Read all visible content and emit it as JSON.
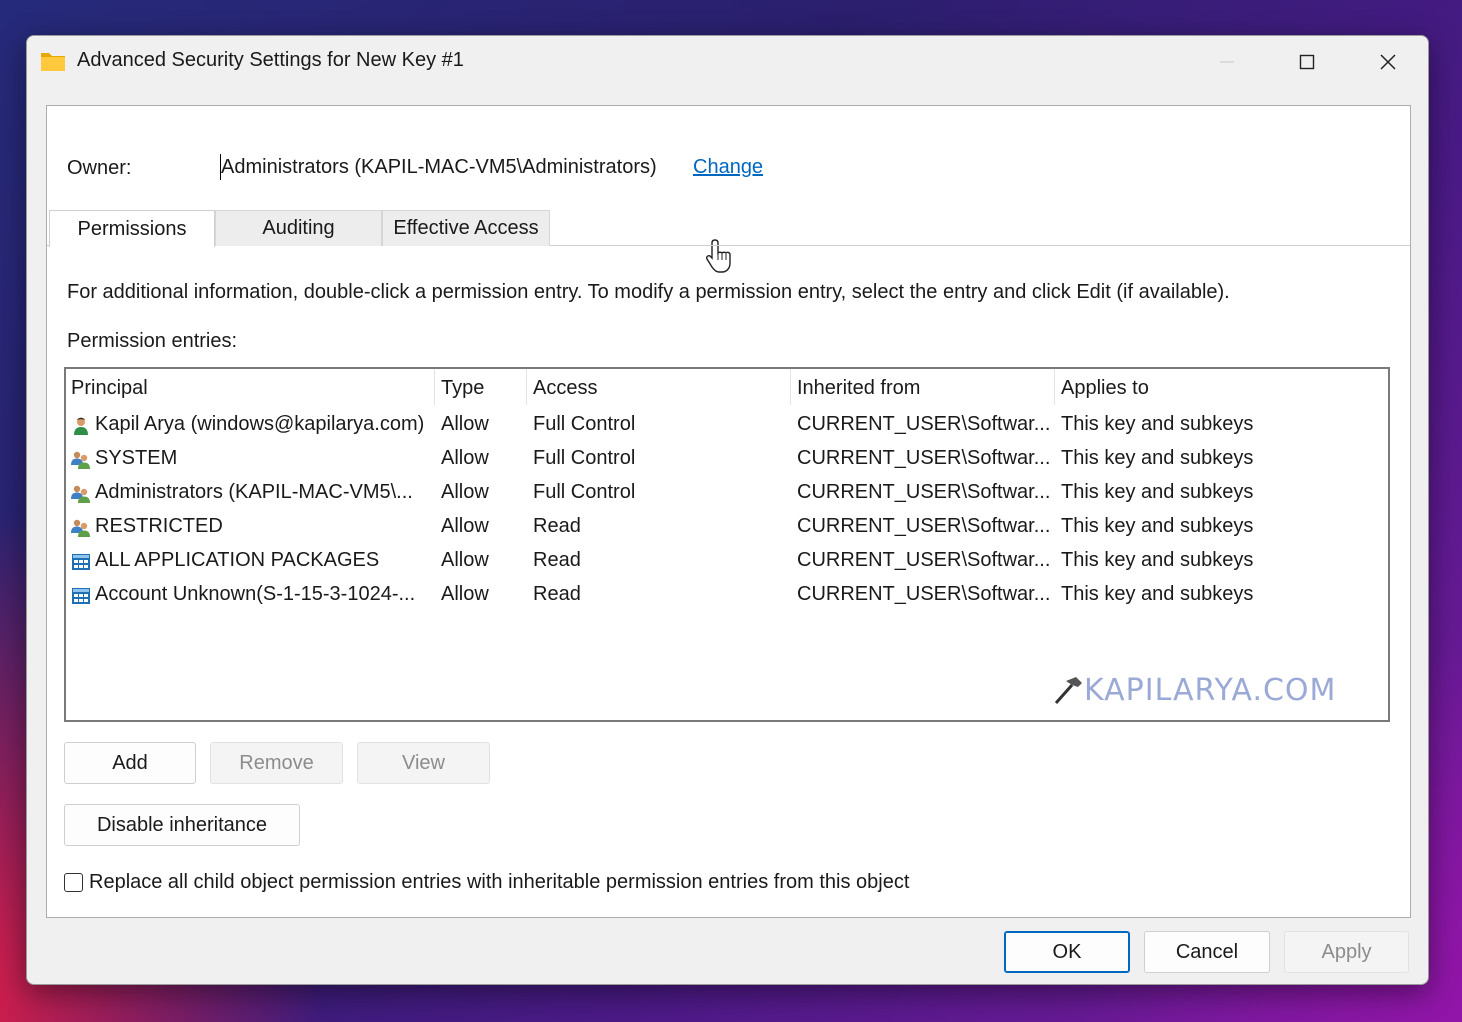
{
  "window": {
    "title": "Advanced Security Settings for New Key #1",
    "icon": "folder-icon",
    "controls": [
      "minimize-icon",
      "maximize-icon",
      "close-icon"
    ]
  },
  "owner": {
    "label": "Owner:",
    "value": "Administrators (KAPIL-MAC-VM5\\Administrators)",
    "change_link": "Change"
  },
  "tabs": [
    {
      "label": "Permissions",
      "active": true
    },
    {
      "label": "Auditing",
      "active": false
    },
    {
      "label": "Effective Access",
      "active": false
    }
  ],
  "permissions": {
    "info_text": "For additional information, double-click a permission entry. To modify a permission entry, select the entry and click Edit (if available).",
    "entries_label": "Permission entries:",
    "columns": [
      "Principal",
      "Type",
      "Access",
      "Inherited from",
      "Applies to"
    ],
    "rows": [
      {
        "icon": "user-icon",
        "principal": "Kapil Arya (windows@kapilarya.com)",
        "type": "Allow",
        "access": "Full Control",
        "inherited_from": "CURRENT_USER\\Softwar...",
        "applies_to": "This key and subkeys"
      },
      {
        "icon": "group-icon",
        "principal": "SYSTEM",
        "type": "Allow",
        "access": "Full Control",
        "inherited_from": "CURRENT_USER\\Softwar...",
        "applies_to": "This key and subkeys"
      },
      {
        "icon": "group-icon",
        "principal": "Administrators (KAPIL-MAC-VM5\\...",
        "type": "Allow",
        "access": "Full Control",
        "inherited_from": "CURRENT_USER\\Softwar...",
        "applies_to": "This key and subkeys"
      },
      {
        "icon": "group-icon",
        "principal": "RESTRICTED",
        "type": "Allow",
        "access": "Read",
        "inherited_from": "CURRENT_USER\\Softwar...",
        "applies_to": "This key and subkeys"
      },
      {
        "icon": "package-icon",
        "principal": "ALL APPLICATION PACKAGES",
        "type": "Allow",
        "access": "Read",
        "inherited_from": "CURRENT_USER\\Softwar...",
        "applies_to": "This key and subkeys"
      },
      {
        "icon": "package-icon",
        "principal": "Account Unknown(S-1-15-3-1024-...",
        "type": "Allow",
        "access": "Read",
        "inherited_from": "CURRENT_USER\\Softwar...",
        "applies_to": "This key and subkeys"
      }
    ],
    "watermark": "KAPILARYA.COM"
  },
  "buttons": {
    "add": "Add",
    "remove": "Remove",
    "view": "View",
    "disable_inheritance": "Disable inheritance",
    "ok": "OK",
    "cancel": "Cancel",
    "apply": "Apply"
  },
  "replace_checkbox": {
    "label": "Replace all child object permission entries with inheritable permission entries from this object",
    "checked": false
  },
  "colors": {
    "link": "#0067c0",
    "window_bg": "#f0f0f0",
    "panel_bg": "#ffffff",
    "disabled_text": "#8c8c8c"
  }
}
